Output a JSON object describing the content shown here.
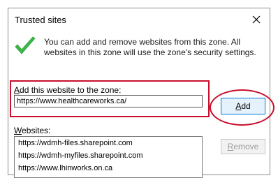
{
  "dialog": {
    "title": "Trusted sites",
    "close_icon": "close-icon",
    "info_icon": "green-checkmark-icon",
    "info_text": "You can add and remove websites from this zone. All websites in this zone will use the zone's security settings.",
    "add_label_key": "A",
    "add_label_rest": "dd this website to the zone:",
    "url_value": "https://www.healthcareworks.ca/",
    "add_button_key": "A",
    "add_button_rest": "dd",
    "websites_label_key": "W",
    "websites_label_rest": "ebsites:",
    "websites": [
      "https://wdmh-files.sharepoint.com",
      "https://wdmh-myfiles.sharepoint.com",
      "https://www.lhinworks.on.ca"
    ],
    "remove_button_key": "R",
    "remove_button_rest": "emove"
  },
  "colors": {
    "highlight_red": "#c8102e",
    "add_button_border": "#0078d7",
    "add_button_bg": "#e5f1fb",
    "check_green": "#3cb84a"
  }
}
